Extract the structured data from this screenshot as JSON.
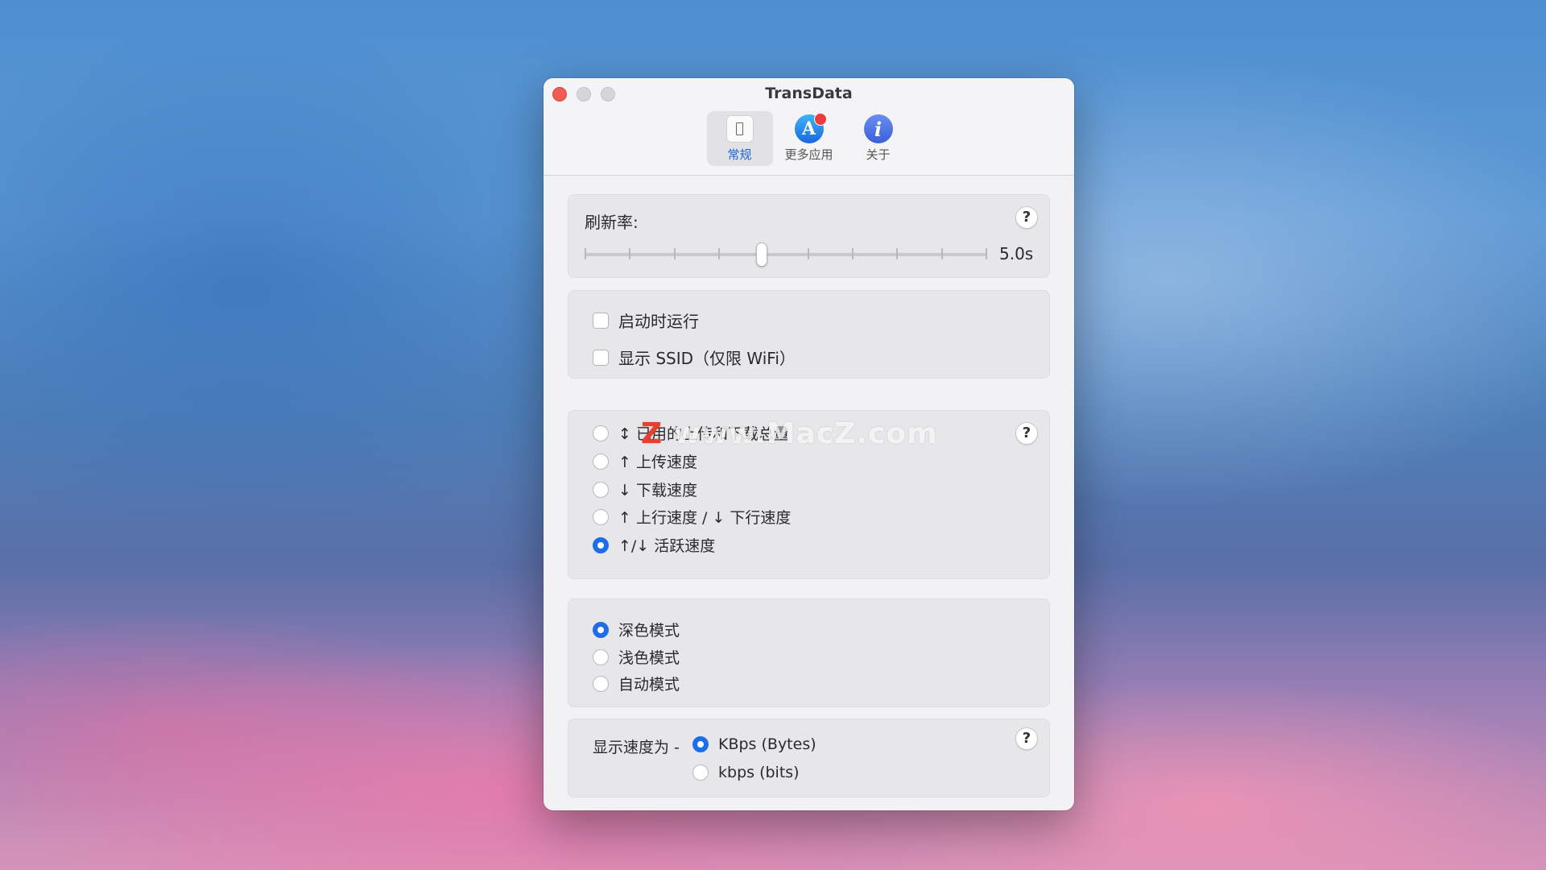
{
  "window": {
    "title": "TransData"
  },
  "toolbar": {
    "items": [
      {
        "label": "常规"
      },
      {
        "label": "更多应用"
      },
      {
        "label": "关于"
      }
    ],
    "store_glyph": "A",
    "about_glyph": "i"
  },
  "refresh": {
    "label": "刷新率:",
    "value_text": "5.0s",
    "help": "?",
    "slider_fraction": 0.44
  },
  "options": {
    "launch_label": "启动时运行",
    "launch_checked": false,
    "ssid_label": "显示 SSID（仅限 WiFi）",
    "ssid_checked": false
  },
  "display_mode": {
    "help": "?",
    "items": [
      {
        "label": "↕ 已用的上传和下载总量",
        "selected": false
      },
      {
        "label": "↑ 上传速度",
        "selected": false
      },
      {
        "label": "↓ 下载速度",
        "selected": false
      },
      {
        "label": "↑ 上行速度 / ↓ 下行速度",
        "selected": false
      },
      {
        "label": "↑/↓ 活跃速度",
        "selected": true
      }
    ]
  },
  "theme": {
    "items": [
      {
        "label": "深色模式",
        "selected": true
      },
      {
        "label": "浅色模式",
        "selected": false
      },
      {
        "label": "自动模式",
        "selected": false
      }
    ]
  },
  "units": {
    "label": "显示速度为 -",
    "help": "?",
    "items": [
      {
        "label": "KBps (Bytes)",
        "selected": true
      },
      {
        "label": "kbps (bits)",
        "selected": false
      }
    ]
  },
  "watermark": {
    "z": "Z",
    "text": " www.MacZ.com"
  },
  "colors": {
    "accent": "#1d6ee8",
    "close": "#ee5c53",
    "badge": "#ee3b3b"
  }
}
